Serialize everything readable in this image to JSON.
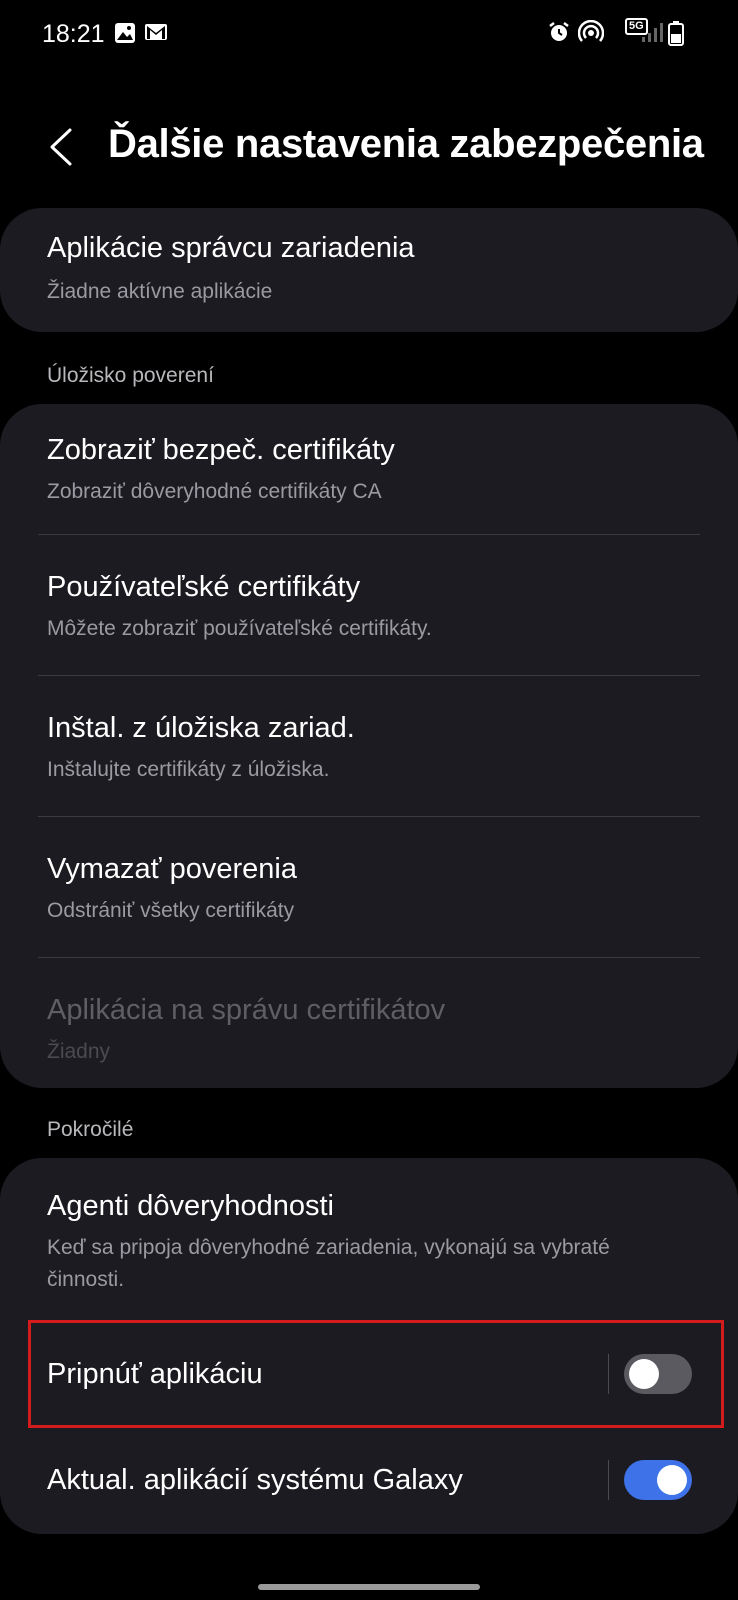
{
  "status_bar": {
    "time": "18:21",
    "left_icons": [
      "image-icon",
      "gmail-icon"
    ],
    "right_icons": [
      "alarm-icon",
      "hotspot-icon",
      "5g-icon",
      "signal-icon",
      "battery-icon"
    ],
    "network": "5G"
  },
  "header": {
    "back_icon": "chevron-left-icon",
    "title": "Ďalšie nastavenia zabezpečenia"
  },
  "device_admin": {
    "title": "Aplikácie správcu zariadenia",
    "subtitle": "Žiadne aktívne aplikácie"
  },
  "credential_storage": {
    "header": "Úložisko poverení",
    "items": [
      {
        "title": "Zobraziť bezpeč. certifikáty",
        "subtitle": "Zobraziť dôveryhodné certifikáty CA",
        "enabled": true
      },
      {
        "title": "Používateľské certifikáty",
        "subtitle": "Môžete zobraziť používateľské certifikáty.",
        "enabled": true
      },
      {
        "title": "Inštal. z úložiska zariad.",
        "subtitle": "Inštalujte certifikáty z úložiska.",
        "enabled": true
      },
      {
        "title": "Vymazať poverenia",
        "subtitle": "Odstrániť všetky certifikáty",
        "enabled": true
      },
      {
        "title": "Aplikácia na správu certifikátov",
        "subtitle": "Žiadny",
        "enabled": false
      }
    ]
  },
  "advanced": {
    "header": "Pokročilé",
    "trust_agents": {
      "title": "Agenti dôveryhodnosti",
      "subtitle": "Keď sa pripoja dôveryhodné zariadenia, vykonajú sa vybraté činnosti."
    },
    "pin_app": {
      "title": "Pripnúť aplikáciu",
      "on": false
    },
    "galaxy_updates": {
      "title": "Aktual. aplikácií systému Galaxy",
      "on": true
    }
  },
  "colors": {
    "background": "#000000",
    "card": "#1c1b22",
    "toggle_on": "#3e72e8",
    "toggle_off": "#5a5a60",
    "highlight": "#d51c1c"
  }
}
